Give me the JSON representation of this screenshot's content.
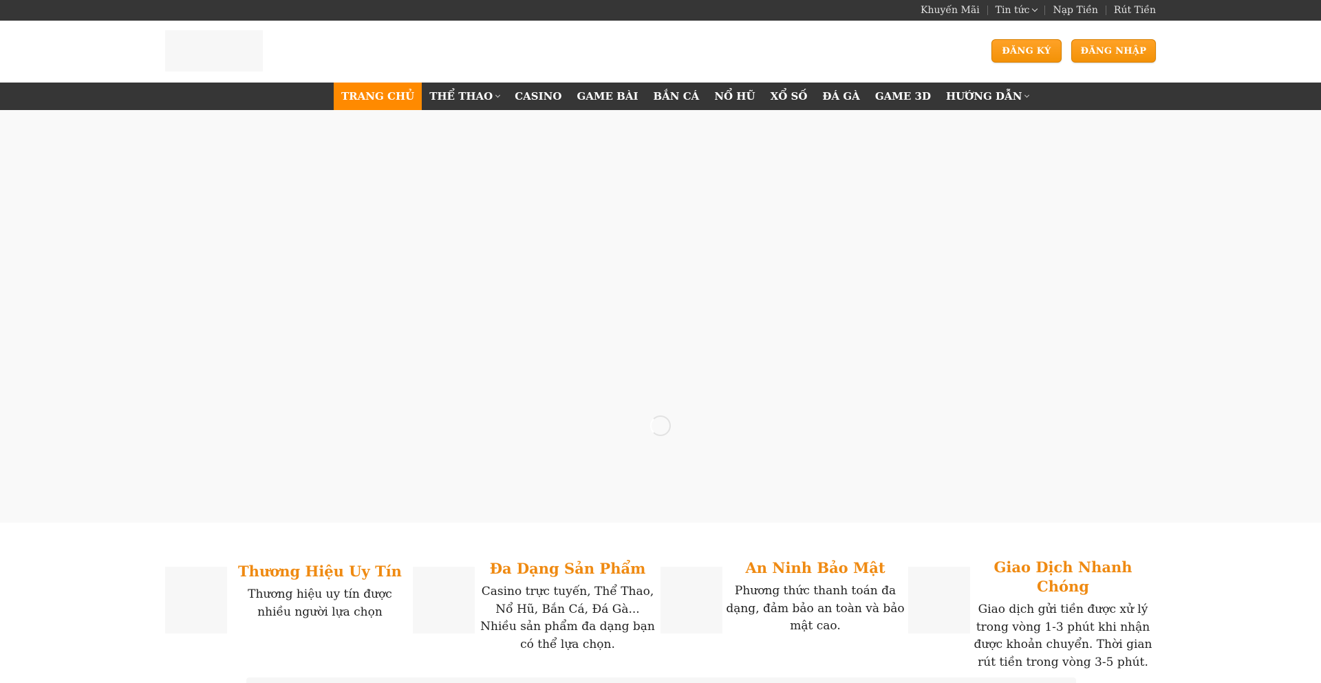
{
  "topbar": {
    "links": [
      {
        "label": "Khuyến Mãi",
        "has_dropdown": false
      },
      {
        "label": "Tin tức",
        "has_dropdown": true
      },
      {
        "label": "Nạp Tiền",
        "has_dropdown": false
      },
      {
        "label": "Rút Tiền",
        "has_dropdown": false
      }
    ]
  },
  "header": {
    "register_label": "ĐĂNG KÝ",
    "login_label": "ĐĂNG NHẬP"
  },
  "nav": {
    "items": [
      {
        "label": "TRANG CHỦ",
        "active": true,
        "has_dropdown": false
      },
      {
        "label": "THỂ THAO",
        "active": false,
        "has_dropdown": true
      },
      {
        "label": "CASINO",
        "active": false,
        "has_dropdown": false
      },
      {
        "label": "GAME BÀI",
        "active": false,
        "has_dropdown": false
      },
      {
        "label": "BẮN CÁ",
        "active": false,
        "has_dropdown": false
      },
      {
        "label": "NỔ HŨ",
        "active": false,
        "has_dropdown": false
      },
      {
        "label": "XỔ SỐ",
        "active": false,
        "has_dropdown": false
      },
      {
        "label": "ĐÁ GÀ",
        "active": false,
        "has_dropdown": false
      },
      {
        "label": "GAME 3D",
        "active": false,
        "has_dropdown": false
      },
      {
        "label": "HƯỚNG DẪN",
        "active": false,
        "has_dropdown": true
      }
    ]
  },
  "features": [
    {
      "title": "Thương Hiệu Uy Tín",
      "text": "Thương hiệu uy tín được nhiều người lựa chọn"
    },
    {
      "title": "Đa Dạng Sản Phẩm",
      "text": "Casino trực tuyến, Thể Thao, Nổ Hũ, Bắn Cá, Đá Gà... Nhiều sản phẩm đa dạng bạn có thể lựa chọn."
    },
    {
      "title": "An Ninh Bảo Mật",
      "text": "Phương thức thanh toán đa dạng, đảm bảo an toàn và bảo mật cao."
    },
    {
      "title": "Giao Dịch Nhanh Chóng",
      "text": "Giao dịch gửi tiền được xử lý trong vòng 1-3 phút khi nhận được khoản chuyển. Thời gian rút tiền trong vòng 3-5 phút."
    }
  ],
  "colors": {
    "accent": "#ff8a00",
    "dark_bar": "#363636",
    "feature_title": "#ef8a12",
    "hero_bg": "#f9f9f9"
  }
}
